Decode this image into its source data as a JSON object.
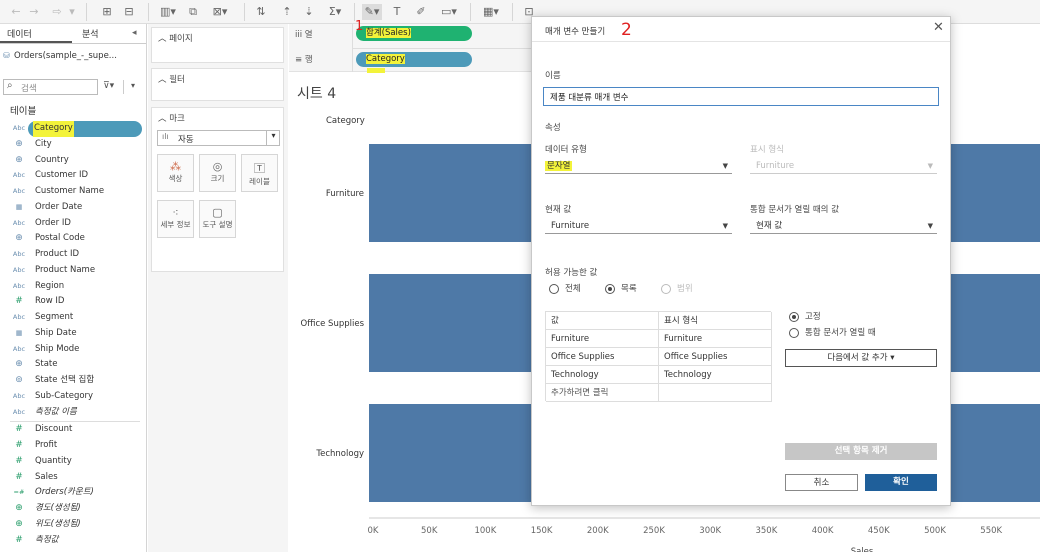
{
  "toolbar": {
    "icons": [
      "left-arrow-icon",
      "right-arrow-icon",
      "redo-icon",
      "add-datasource-icon",
      "pause-icon",
      "new-worksheet-icon",
      "duplicate-icon",
      "clear-icon",
      "swap-icon",
      "sort-asc-icon",
      "sort-desc-icon",
      "totals-icon",
      "highlight-icon",
      "label-icon",
      "annotate-icon",
      "fit-icon",
      "show-me-icon",
      "tooltip-icon"
    ]
  },
  "datapane": {
    "tab_data": "데이터",
    "tab_analysis": "분석",
    "datasource": "Orders(sample_-_supe...",
    "search_placeholder": "검색",
    "tables_heading": "테이블",
    "fields": [
      {
        "icon": "Abc",
        "label": "Category",
        "type": "dim",
        "selected": true
      },
      {
        "icon": "globe",
        "label": "City",
        "type": "dim"
      },
      {
        "icon": "globe",
        "label": "Country",
        "type": "dim"
      },
      {
        "icon": "Abc",
        "label": "Customer ID",
        "type": "dim"
      },
      {
        "icon": "Abc",
        "label": "Customer Name",
        "type": "dim"
      },
      {
        "icon": "date",
        "label": "Order Date",
        "type": "dim"
      },
      {
        "icon": "Abc",
        "label": "Order ID",
        "type": "dim"
      },
      {
        "icon": "globe",
        "label": "Postal Code",
        "type": "dim"
      },
      {
        "icon": "Abc",
        "label": "Product ID",
        "type": "dim"
      },
      {
        "icon": "Abc",
        "label": "Product Name",
        "type": "dim"
      },
      {
        "icon": "Abc",
        "label": "Region",
        "type": "dim"
      },
      {
        "icon": "#",
        "label": "Row ID",
        "type": "dim"
      },
      {
        "icon": "Abc",
        "label": "Segment",
        "type": "dim"
      },
      {
        "icon": "date",
        "label": "Ship Date",
        "type": "dim"
      },
      {
        "icon": "Abc",
        "label": "Ship Mode",
        "type": "dim"
      },
      {
        "icon": "globe",
        "label": "State",
        "type": "dim"
      },
      {
        "icon": "set",
        "label": "State 선택 집합",
        "type": "dim"
      },
      {
        "icon": "Abc",
        "label": "Sub-Category",
        "type": "dim"
      },
      {
        "icon": "Abc",
        "label": "측정값 이름",
        "type": "dim",
        "italic": true
      },
      {
        "icon": "#",
        "label": "Discount",
        "type": "meas"
      },
      {
        "icon": "#",
        "label": "Profit",
        "type": "meas"
      },
      {
        "icon": "#",
        "label": "Quantity",
        "type": "meas"
      },
      {
        "icon": "#",
        "label": "Sales",
        "type": "meas"
      },
      {
        "icon": "=#",
        "label": "Orders(카운트)",
        "type": "meas",
        "italic": true
      },
      {
        "icon": "globe",
        "label": "경도(생성됨)",
        "type": "meas",
        "italic": true
      },
      {
        "icon": "globe",
        "label": "위도(생성됨)",
        "type": "meas",
        "italic": true
      },
      {
        "icon": "#",
        "label": "측정값",
        "type": "meas",
        "italic": true
      }
    ]
  },
  "cards": {
    "pages": "페이지",
    "filters": "필터",
    "marks": "마크",
    "mark_type": "자동",
    "mark_buttons": [
      "색상",
      "크기",
      "레이블",
      "세부 정보",
      "도구 설명"
    ]
  },
  "shelves": {
    "columns_label": "열",
    "rows_label": "행",
    "columns_pill": "합계(Sales)",
    "rows_pill": "Category"
  },
  "view": {
    "sheet_title": "시트 4",
    "row_header": "Category",
    "x_axis_title": "Sales"
  },
  "annotations": {
    "one": "1",
    "two": "2"
  },
  "dialog": {
    "title": "매개 변수 만들기",
    "name_label": "이름",
    "name_value": "제품 대분류 매개 변수",
    "properties_label": "속성",
    "data_type_label": "데이터 유형",
    "data_type_value": "문자열",
    "display_format_label": "표시 형식",
    "display_format_value": "Furniture",
    "current_value_label": "현재 값",
    "current_value": "Furniture",
    "workbook_open_label": "통합 문서가 열릴 때의 값",
    "workbook_open_value": "현재 값",
    "allowable_label": "허용 가능한 값",
    "allow_all": "전체",
    "allow_list": "목록",
    "allow_range": "범위",
    "table_headers": [
      "값",
      "표시 형식"
    ],
    "table_rows": [
      [
        "Furniture",
        "Furniture"
      ],
      [
        "Office Supplies",
        "Office Supplies"
      ],
      [
        "Technology",
        "Technology"
      ],
      [
        "추가하려면 클릭",
        ""
      ]
    ],
    "fixed_label": "고정",
    "when_open_label": "통합 문서가 열릴 때",
    "add_values_button": "다음에서 값 추가",
    "remove_button": "선택 항목 제거",
    "cancel_button": "취소",
    "ok_button": "확인"
  },
  "chart_data": {
    "type": "bar",
    "orientation": "horizontal",
    "categories": [
      "Furniture",
      "Office Supplies",
      "Technology"
    ],
    "xlabel": "Sales",
    "ylabel": "Category",
    "x_ticks": [
      "0K",
      "50K",
      "100K",
      "150K",
      "200K",
      "250K",
      "300K",
      "350K",
      "400K",
      "450K",
      "500K",
      "550K",
      "60"
    ],
    "bar_color": "#4e79a7"
  }
}
